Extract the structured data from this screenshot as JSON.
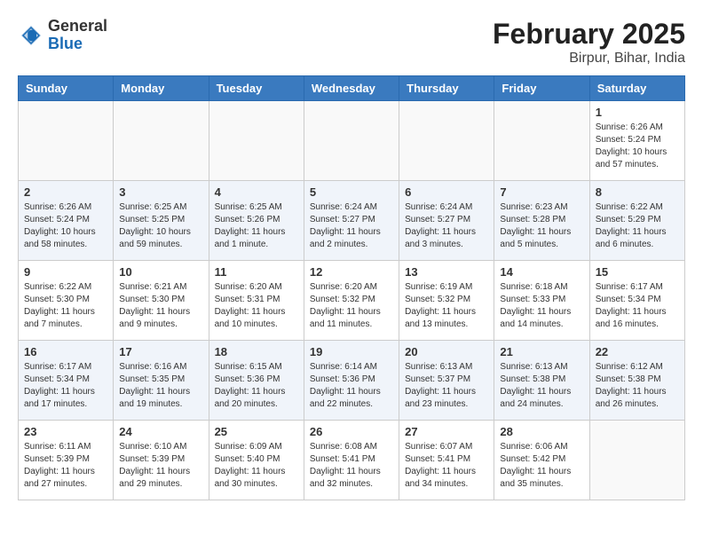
{
  "header": {
    "logo_general": "General",
    "logo_blue": "Blue",
    "title": "February 2025",
    "subtitle": "Birpur, Bihar, India"
  },
  "days_of_week": [
    "Sunday",
    "Monday",
    "Tuesday",
    "Wednesday",
    "Thursday",
    "Friday",
    "Saturday"
  ],
  "weeks": [
    {
      "alt": false,
      "days": [
        {
          "num": "",
          "info": ""
        },
        {
          "num": "",
          "info": ""
        },
        {
          "num": "",
          "info": ""
        },
        {
          "num": "",
          "info": ""
        },
        {
          "num": "",
          "info": ""
        },
        {
          "num": "",
          "info": ""
        },
        {
          "num": "1",
          "info": "Sunrise: 6:26 AM\nSunset: 5:24 PM\nDaylight: 10 hours\nand 57 minutes."
        }
      ]
    },
    {
      "alt": true,
      "days": [
        {
          "num": "2",
          "info": "Sunrise: 6:26 AM\nSunset: 5:24 PM\nDaylight: 10 hours\nand 58 minutes."
        },
        {
          "num": "3",
          "info": "Sunrise: 6:25 AM\nSunset: 5:25 PM\nDaylight: 10 hours\nand 59 minutes."
        },
        {
          "num": "4",
          "info": "Sunrise: 6:25 AM\nSunset: 5:26 PM\nDaylight: 11 hours\nand 1 minute."
        },
        {
          "num": "5",
          "info": "Sunrise: 6:24 AM\nSunset: 5:27 PM\nDaylight: 11 hours\nand 2 minutes."
        },
        {
          "num": "6",
          "info": "Sunrise: 6:24 AM\nSunset: 5:27 PM\nDaylight: 11 hours\nand 3 minutes."
        },
        {
          "num": "7",
          "info": "Sunrise: 6:23 AM\nSunset: 5:28 PM\nDaylight: 11 hours\nand 5 minutes."
        },
        {
          "num": "8",
          "info": "Sunrise: 6:22 AM\nSunset: 5:29 PM\nDaylight: 11 hours\nand 6 minutes."
        }
      ]
    },
    {
      "alt": false,
      "days": [
        {
          "num": "9",
          "info": "Sunrise: 6:22 AM\nSunset: 5:30 PM\nDaylight: 11 hours\nand 7 minutes."
        },
        {
          "num": "10",
          "info": "Sunrise: 6:21 AM\nSunset: 5:30 PM\nDaylight: 11 hours\nand 9 minutes."
        },
        {
          "num": "11",
          "info": "Sunrise: 6:20 AM\nSunset: 5:31 PM\nDaylight: 11 hours\nand 10 minutes."
        },
        {
          "num": "12",
          "info": "Sunrise: 6:20 AM\nSunset: 5:32 PM\nDaylight: 11 hours\nand 11 minutes."
        },
        {
          "num": "13",
          "info": "Sunrise: 6:19 AM\nSunset: 5:32 PM\nDaylight: 11 hours\nand 13 minutes."
        },
        {
          "num": "14",
          "info": "Sunrise: 6:18 AM\nSunset: 5:33 PM\nDaylight: 11 hours\nand 14 minutes."
        },
        {
          "num": "15",
          "info": "Sunrise: 6:17 AM\nSunset: 5:34 PM\nDaylight: 11 hours\nand 16 minutes."
        }
      ]
    },
    {
      "alt": true,
      "days": [
        {
          "num": "16",
          "info": "Sunrise: 6:17 AM\nSunset: 5:34 PM\nDaylight: 11 hours\nand 17 minutes."
        },
        {
          "num": "17",
          "info": "Sunrise: 6:16 AM\nSunset: 5:35 PM\nDaylight: 11 hours\nand 19 minutes."
        },
        {
          "num": "18",
          "info": "Sunrise: 6:15 AM\nSunset: 5:36 PM\nDaylight: 11 hours\nand 20 minutes."
        },
        {
          "num": "19",
          "info": "Sunrise: 6:14 AM\nSunset: 5:36 PM\nDaylight: 11 hours\nand 22 minutes."
        },
        {
          "num": "20",
          "info": "Sunrise: 6:13 AM\nSunset: 5:37 PM\nDaylight: 11 hours\nand 23 minutes."
        },
        {
          "num": "21",
          "info": "Sunrise: 6:13 AM\nSunset: 5:38 PM\nDaylight: 11 hours\nand 24 minutes."
        },
        {
          "num": "22",
          "info": "Sunrise: 6:12 AM\nSunset: 5:38 PM\nDaylight: 11 hours\nand 26 minutes."
        }
      ]
    },
    {
      "alt": false,
      "days": [
        {
          "num": "23",
          "info": "Sunrise: 6:11 AM\nSunset: 5:39 PM\nDaylight: 11 hours\nand 27 minutes."
        },
        {
          "num": "24",
          "info": "Sunrise: 6:10 AM\nSunset: 5:39 PM\nDaylight: 11 hours\nand 29 minutes."
        },
        {
          "num": "25",
          "info": "Sunrise: 6:09 AM\nSunset: 5:40 PM\nDaylight: 11 hours\nand 30 minutes."
        },
        {
          "num": "26",
          "info": "Sunrise: 6:08 AM\nSunset: 5:41 PM\nDaylight: 11 hours\nand 32 minutes."
        },
        {
          "num": "27",
          "info": "Sunrise: 6:07 AM\nSunset: 5:41 PM\nDaylight: 11 hours\nand 34 minutes."
        },
        {
          "num": "28",
          "info": "Sunrise: 6:06 AM\nSunset: 5:42 PM\nDaylight: 11 hours\nand 35 minutes."
        },
        {
          "num": "",
          "info": ""
        }
      ]
    }
  ]
}
